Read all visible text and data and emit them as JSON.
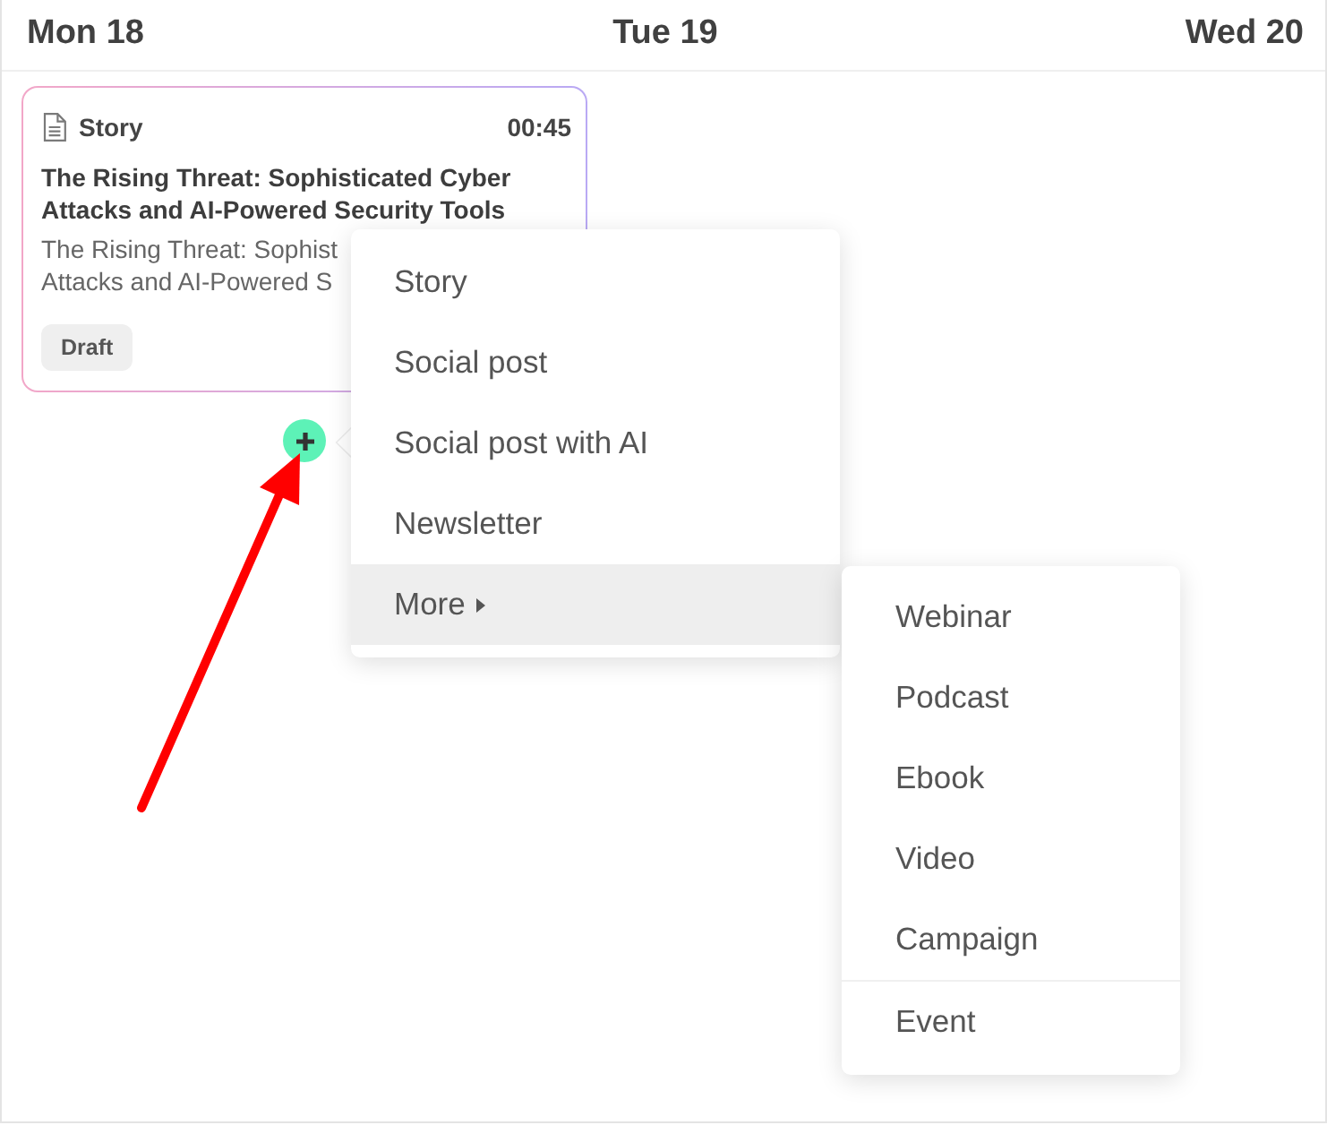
{
  "calendar": {
    "days": [
      {
        "label": "Mon 18"
      },
      {
        "label": "Tue 19"
      },
      {
        "label": "Wed 20"
      }
    ]
  },
  "card": {
    "type": "Story",
    "time": "00:45",
    "title": "The Rising Threat: Sophisticated Cyber Attacks and AI-Powered Security Tools",
    "description_lines": [
      "The Rising Threat: Sophist",
      "Attacks and AI-Powered S"
    ],
    "status": "Draft"
  },
  "add_menu": {
    "items": [
      {
        "label": "Story",
        "kind": "action",
        "selected": false
      },
      {
        "label": "Social post",
        "kind": "action",
        "selected": false
      },
      {
        "label": "Social post with AI",
        "kind": "action",
        "selected": false
      },
      {
        "label": "Newsletter",
        "kind": "action",
        "selected": false
      },
      {
        "label": "More",
        "kind": "submenu",
        "selected": true
      }
    ]
  },
  "submenu": {
    "groups": [
      {
        "items": [
          {
            "label": "Webinar",
            "selected": false
          },
          {
            "label": "Podcast",
            "selected": false
          },
          {
            "label": "Ebook",
            "selected": false
          },
          {
            "label": "Video",
            "selected": false
          },
          {
            "label": "Campaign",
            "selected": false
          }
        ]
      },
      {
        "items": [
          {
            "label": "Event",
            "selected": false
          }
        ]
      }
    ]
  }
}
